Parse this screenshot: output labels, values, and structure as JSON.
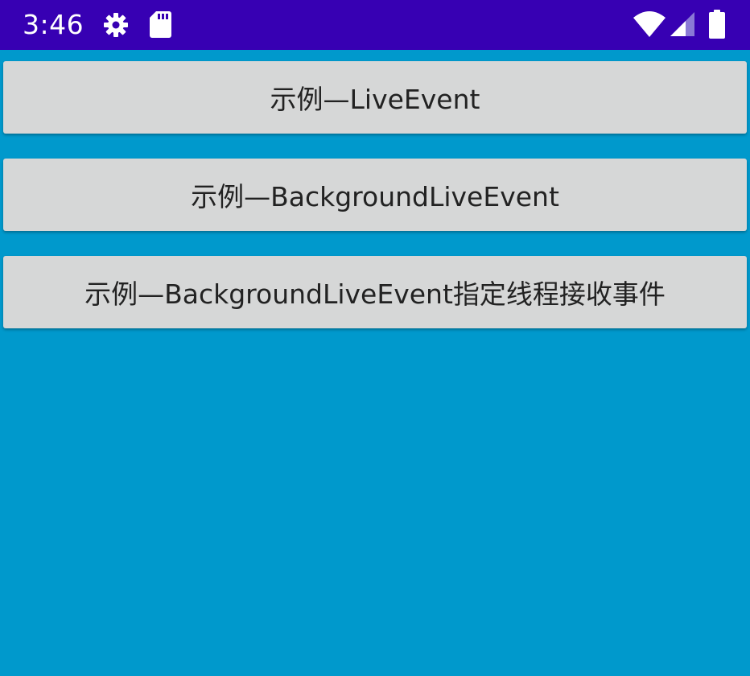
{
  "status_bar": {
    "time": "3:46",
    "background_color": "#3700b3",
    "icons": [
      "gear-icon",
      "sd-card-icon",
      "wifi-icon",
      "signal-icon",
      "battery-icon"
    ]
  },
  "main": {
    "background_color": "#0099cc",
    "buttons": [
      {
        "label": "示例—LiveEvent"
      },
      {
        "label": "示例—BackgroundLiveEvent"
      },
      {
        "label": "示例—BackgroundLiveEvent指定线程接收事件"
      }
    ]
  }
}
